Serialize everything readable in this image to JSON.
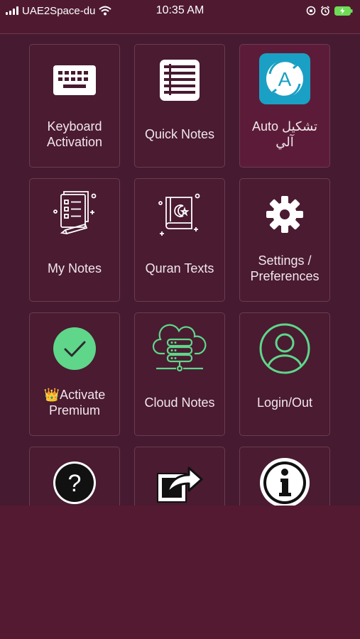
{
  "status_bar": {
    "carrier": "UAE2Space-du",
    "time": "10:35 AM"
  },
  "tiles": [
    {
      "label": "Keyboard\nActivation",
      "icon": "keyboard-icon"
    },
    {
      "label": "Quick Notes",
      "icon": "notes-list-icon"
    },
    {
      "label": "Auto تشكيل\nآلي",
      "icon": "auto-tashkeel-icon"
    },
    {
      "label": "My Notes",
      "icon": "document-pencil-icon"
    },
    {
      "label": "Quran Texts",
      "icon": "quran-book-icon"
    },
    {
      "label": "Settings /\nPreferences",
      "icon": "gear-icon"
    },
    {
      "label": "👑Activate\nPremium",
      "icon": "checkmark-circle-icon"
    },
    {
      "label": "Cloud Notes",
      "icon": "cloud-server-icon"
    },
    {
      "label": "Login/Out",
      "icon": "user-circle-icon"
    },
    {
      "label": "",
      "icon": "help-question-icon"
    },
    {
      "label": "",
      "icon": "share-icon"
    },
    {
      "label": "",
      "icon": "info-icon"
    }
  ],
  "colors": {
    "background": "#4f1a30",
    "panel": "#461a30",
    "accent_green": "#5fd68a",
    "auto_icon_bg": "#1aa0c4"
  }
}
